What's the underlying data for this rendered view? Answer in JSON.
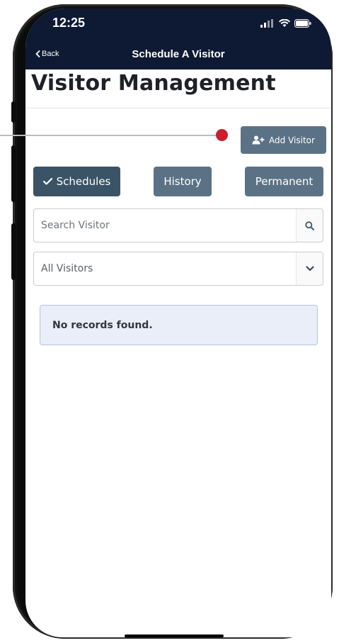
{
  "status_bar": {
    "time": "12:25"
  },
  "nav_bar": {
    "back_label": "Back",
    "title": "Schedule A Visitor"
  },
  "page": {
    "title": "Visitor Management"
  },
  "actions": {
    "add_visitor_label": "Add Visitor"
  },
  "tabs": [
    {
      "label": "Schedules",
      "active": true,
      "icon": "check-icon"
    },
    {
      "label": "History",
      "active": false
    },
    {
      "label": "Permanent",
      "active": false
    }
  ],
  "search": {
    "placeholder": "Search Visitor",
    "value": "",
    "icon": "search-icon"
  },
  "filter": {
    "selected": "All Visitors",
    "icon": "chevron-down-icon"
  },
  "results": {
    "empty_message": "No records found."
  },
  "colors": {
    "nav_background": "#0e1a33",
    "button_primary": "#5b7286",
    "button_active": "#3a5366",
    "annotation_dot": "#c8202f",
    "alert_background": "#e9eef8",
    "alert_border": "#b7c3dc"
  }
}
